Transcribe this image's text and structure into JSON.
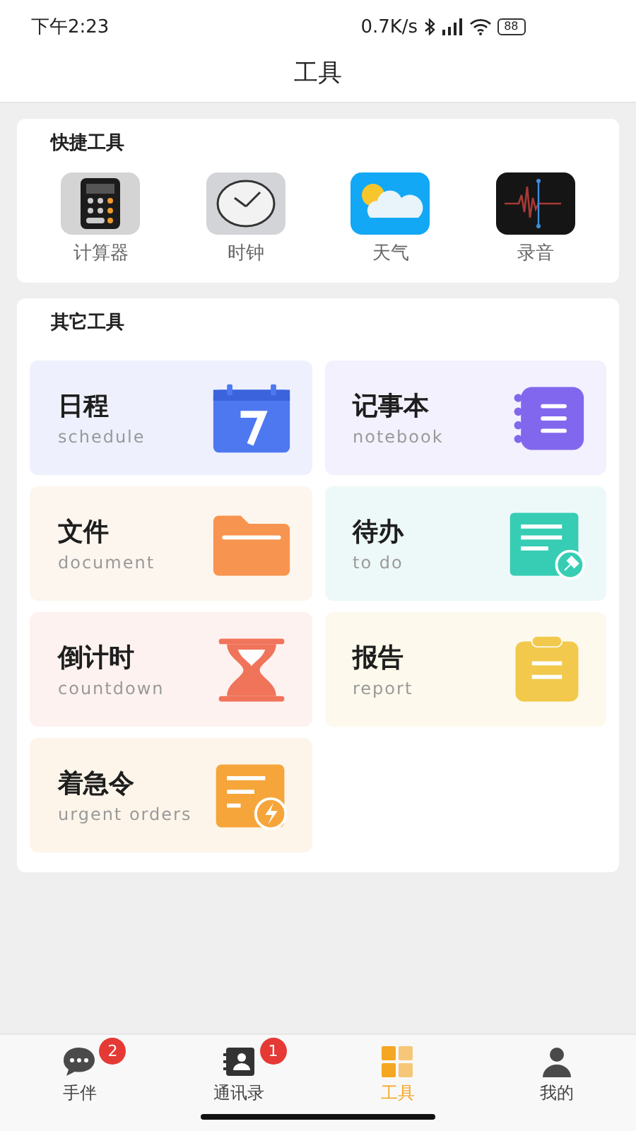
{
  "status_bar": {
    "time": "下午2:23",
    "speed": "0.7K/s",
    "battery": "88"
  },
  "header": {
    "title": "工具"
  },
  "quick_tools": {
    "title": "快捷工具",
    "items": [
      {
        "kind": "calculator",
        "label": "计算器"
      },
      {
        "kind": "clock",
        "label": "时钟"
      },
      {
        "kind": "weather",
        "label": "天气"
      },
      {
        "kind": "recorder",
        "label": "录音"
      }
    ]
  },
  "other_tools": {
    "title": "其它工具",
    "items": [
      {
        "kind": "calendar",
        "title": "日程",
        "subtitle": "schedule"
      },
      {
        "kind": "notebook",
        "title": "记事本",
        "subtitle": "notebook"
      },
      {
        "kind": "folder",
        "title": "文件",
        "subtitle": "document"
      },
      {
        "kind": "todo",
        "title": "待办",
        "subtitle": "to do"
      },
      {
        "kind": "hourglass",
        "title": "倒计时",
        "subtitle": "countdown"
      },
      {
        "kind": "report",
        "title": "报告",
        "subtitle": "report"
      },
      {
        "kind": "urgent",
        "title": "着急令",
        "subtitle": "urgent orders"
      }
    ]
  },
  "bottom_nav": [
    {
      "kind": "chat",
      "label": "手伴",
      "badge": "2",
      "selected": false
    },
    {
      "kind": "contacts",
      "label": "通讯录",
      "badge": "1",
      "selected": false
    },
    {
      "kind": "grid",
      "label": "工具",
      "selected": true
    },
    {
      "kind": "person",
      "label": "我的",
      "selected": false
    }
  ]
}
